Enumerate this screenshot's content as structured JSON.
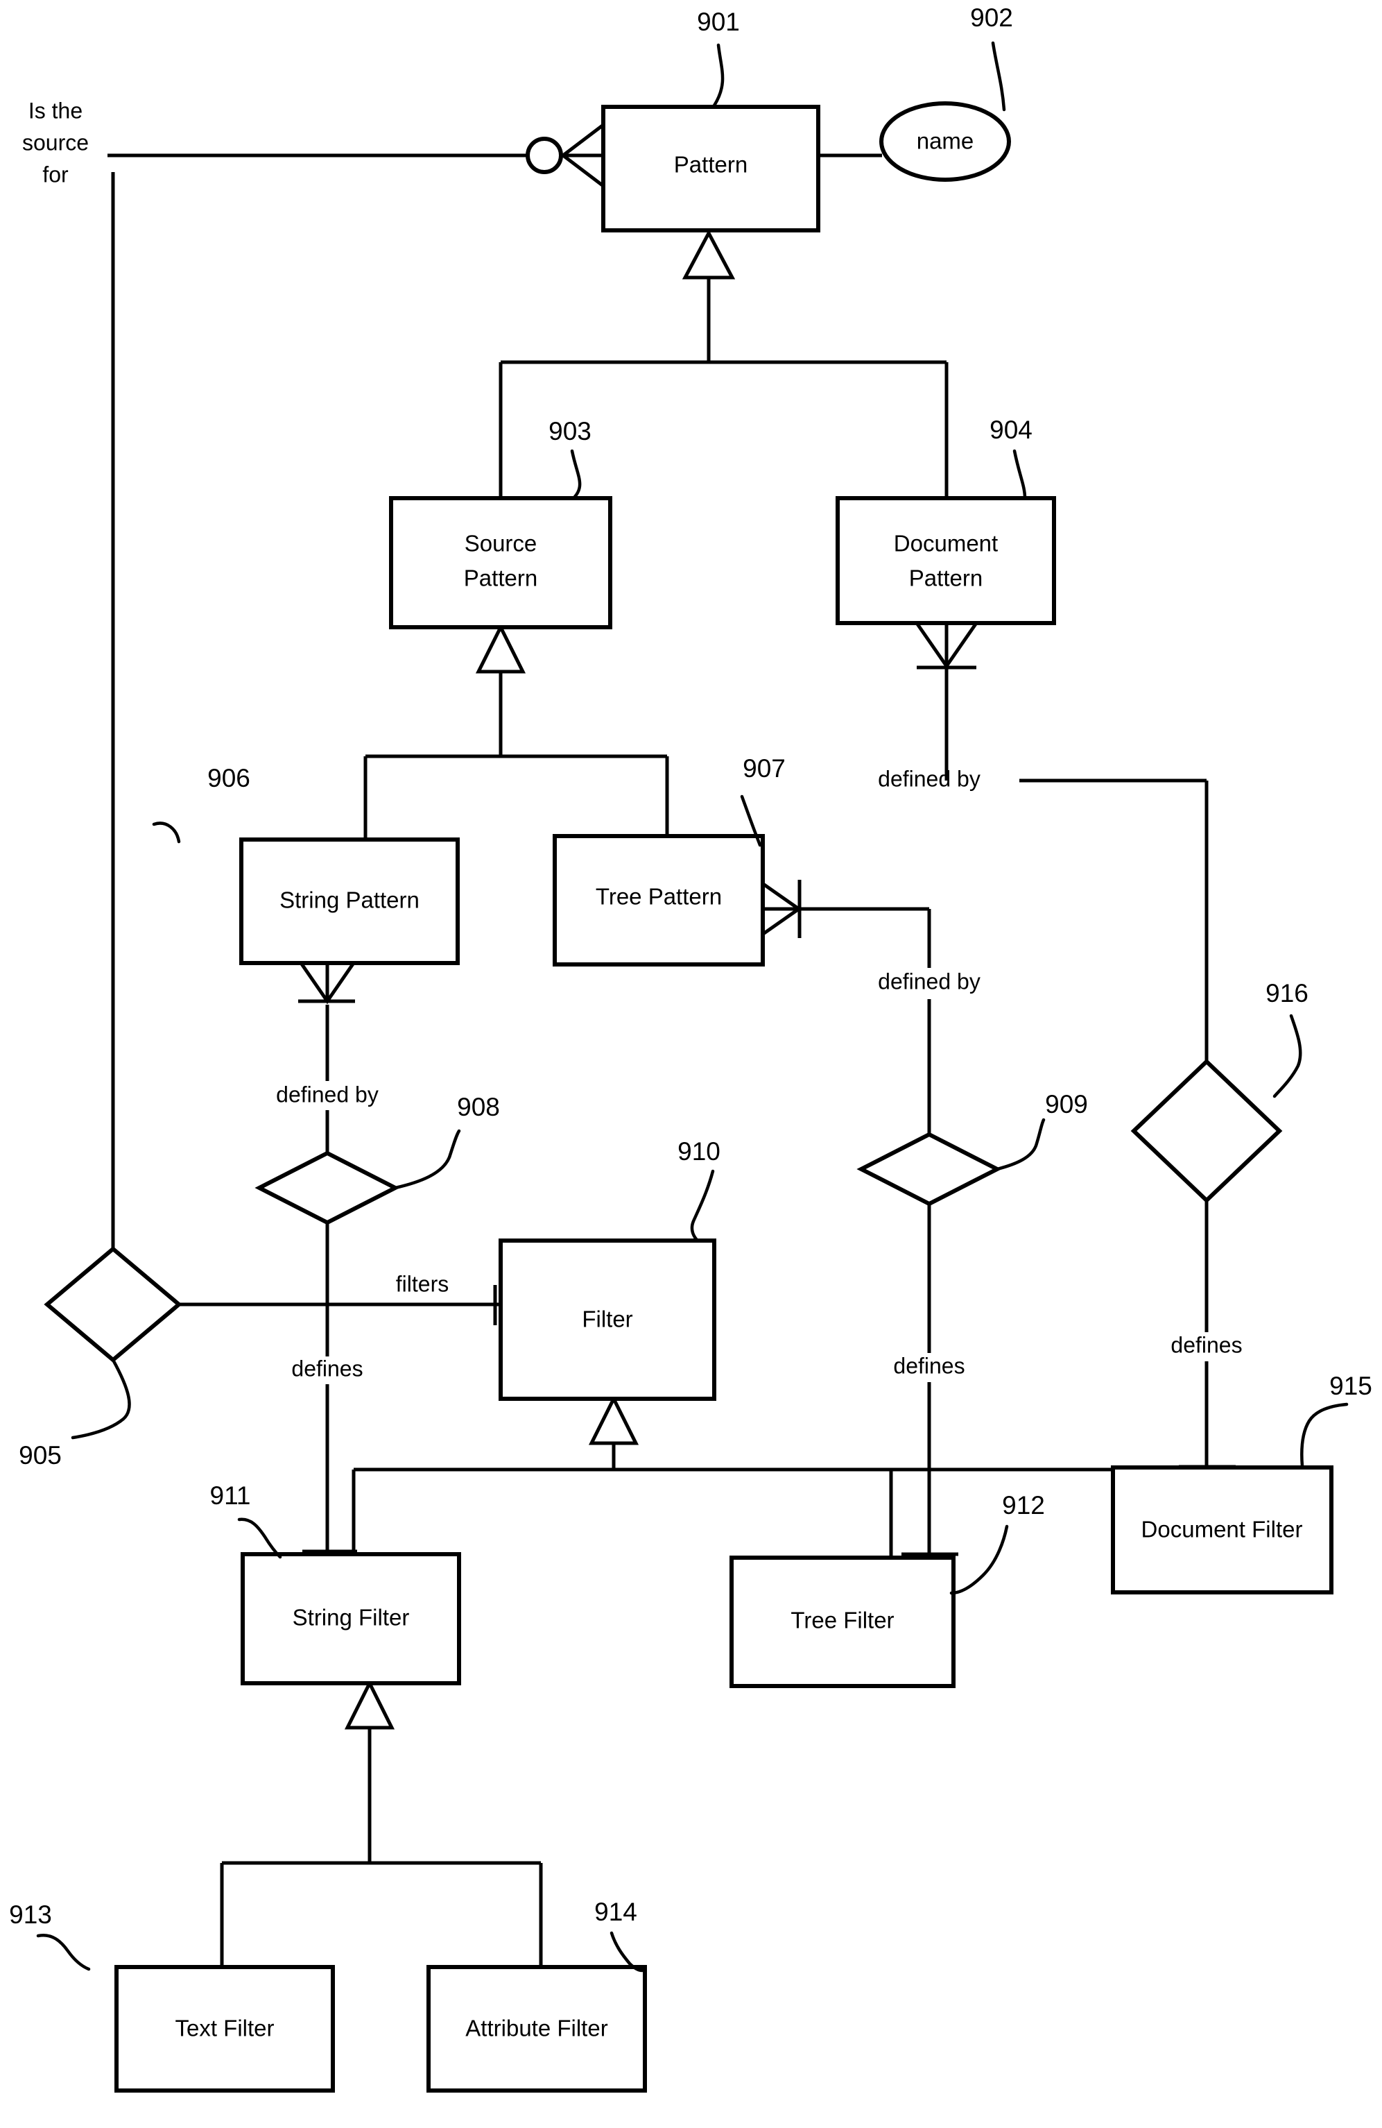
{
  "figure": {
    "type": "entity-relationship-diagram",
    "title": "Pattern and Filter entity relationship diagram"
  },
  "entities": [
    {
      "id": "pattern",
      "ref": "901",
      "label": "Pattern",
      "lines": [
        "Pattern"
      ]
    },
    {
      "id": "source_pattern",
      "ref": "903",
      "label": "Source Pattern",
      "lines": [
        "Source",
        "Pattern"
      ]
    },
    {
      "id": "document_pattern",
      "ref": "904",
      "label": "Document Pattern",
      "lines": [
        "Document",
        "Pattern"
      ]
    },
    {
      "id": "string_pattern",
      "ref": "906",
      "label": "String Pattern",
      "lines": [
        "String Pattern"
      ]
    },
    {
      "id": "tree_pattern",
      "ref": "907",
      "label": "Tree Pattern",
      "lines": [
        "Tree Pattern"
      ]
    },
    {
      "id": "filter",
      "ref": "910",
      "label": "Filter",
      "lines": [
        "Filter"
      ]
    },
    {
      "id": "string_filter",
      "ref": "911",
      "label": "String Filter",
      "lines": [
        "String Filter"
      ]
    },
    {
      "id": "tree_filter",
      "ref": "912",
      "label": "Tree Filter",
      "lines": [
        "Tree Filter"
      ]
    },
    {
      "id": "document_filter",
      "ref": "915",
      "label": "Document Filter",
      "lines": [
        "Document Filter"
      ]
    },
    {
      "id": "text_filter",
      "ref": "913",
      "label": "Text Filter",
      "lines": [
        "Text Filter"
      ]
    },
    {
      "id": "attribute_filter",
      "ref": "914",
      "label": "Attribute Filter",
      "lines": [
        "Attribute Filter"
      ]
    }
  ],
  "attributes": [
    {
      "id": "name",
      "ref": "902",
      "label": "name",
      "owner": "pattern"
    }
  ],
  "relationships": [
    {
      "id": "rel905",
      "ref": "905",
      "shape": "diamond"
    },
    {
      "id": "rel908",
      "ref": "908",
      "shape": "diamond"
    },
    {
      "id": "rel909",
      "ref": "909",
      "shape": "diamond"
    },
    {
      "id": "rel916",
      "ref": "916",
      "shape": "diamond"
    }
  ],
  "edge_labels": {
    "is_the_source_for": [
      "Is the",
      "source",
      "for"
    ],
    "defined_by_string": "defined by",
    "defined_by_tree": "defined by",
    "defined_by_document": "defined by",
    "defines_string": "defines",
    "defines_tree": "defines",
    "defines_document": "defines",
    "filters": "filters"
  },
  "reference_numerals": [
    "901",
    "902",
    "903",
    "904",
    "905",
    "906",
    "907",
    "908",
    "909",
    "910",
    "911",
    "912",
    "913",
    "914",
    "915",
    "916"
  ],
  "colors": {
    "stroke": "#000000",
    "fill": "#ffffff",
    "background": "#ffffff"
  }
}
